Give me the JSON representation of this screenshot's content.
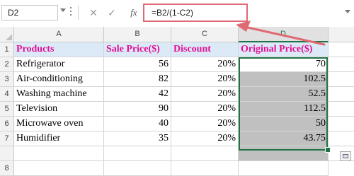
{
  "name_box": {
    "value": "D2"
  },
  "formula_bar": {
    "cancel_symbol": "✕",
    "enter_symbol": "✓",
    "fx_label": "fx",
    "formula": "=B2/(1-C2)"
  },
  "columns": [
    "A",
    "B",
    "C",
    "D"
  ],
  "header_row": {
    "row_number": "1",
    "cells": [
      "Products",
      "Sale Price($)",
      "Discount",
      "Original Price($)"
    ]
  },
  "rows": [
    {
      "row_number": "2",
      "product": "Refrigerator",
      "sale_price": "56",
      "discount": "20%",
      "original_price": "70"
    },
    {
      "row_number": "3",
      "product": "Air-conditioning",
      "sale_price": "82",
      "discount": "20%",
      "original_price": "102.5"
    },
    {
      "row_number": "4",
      "product": "Washing machine",
      "sale_price": "42",
      "discount": "20%",
      "original_price": "52.5"
    },
    {
      "row_number": "5",
      "product": "Television",
      "sale_price": "90",
      "discount": "20%",
      "original_price": "112.5"
    },
    {
      "row_number": "6",
      "product": "Microwave oven",
      "sale_price": "40",
      "discount": "20%",
      "original_price": "50"
    },
    {
      "row_number": "7",
      "product": "Humidifier",
      "sale_price": "35",
      "discount": "20%",
      "original_price": "43.75"
    }
  ],
  "empty_row": {
    "row_number": "8"
  },
  "colors": {
    "header_text": "#e20e94",
    "header_fill": "#dceaf7",
    "selection_fill": "#c0c0c0",
    "selection_border": "#217346",
    "callout_arrow": "#e06a73"
  },
  "icons": {
    "name_box_dropdown": "chevron-down-icon",
    "callout": "arrow-icon",
    "quick_analysis": "quick-analysis-icon"
  }
}
